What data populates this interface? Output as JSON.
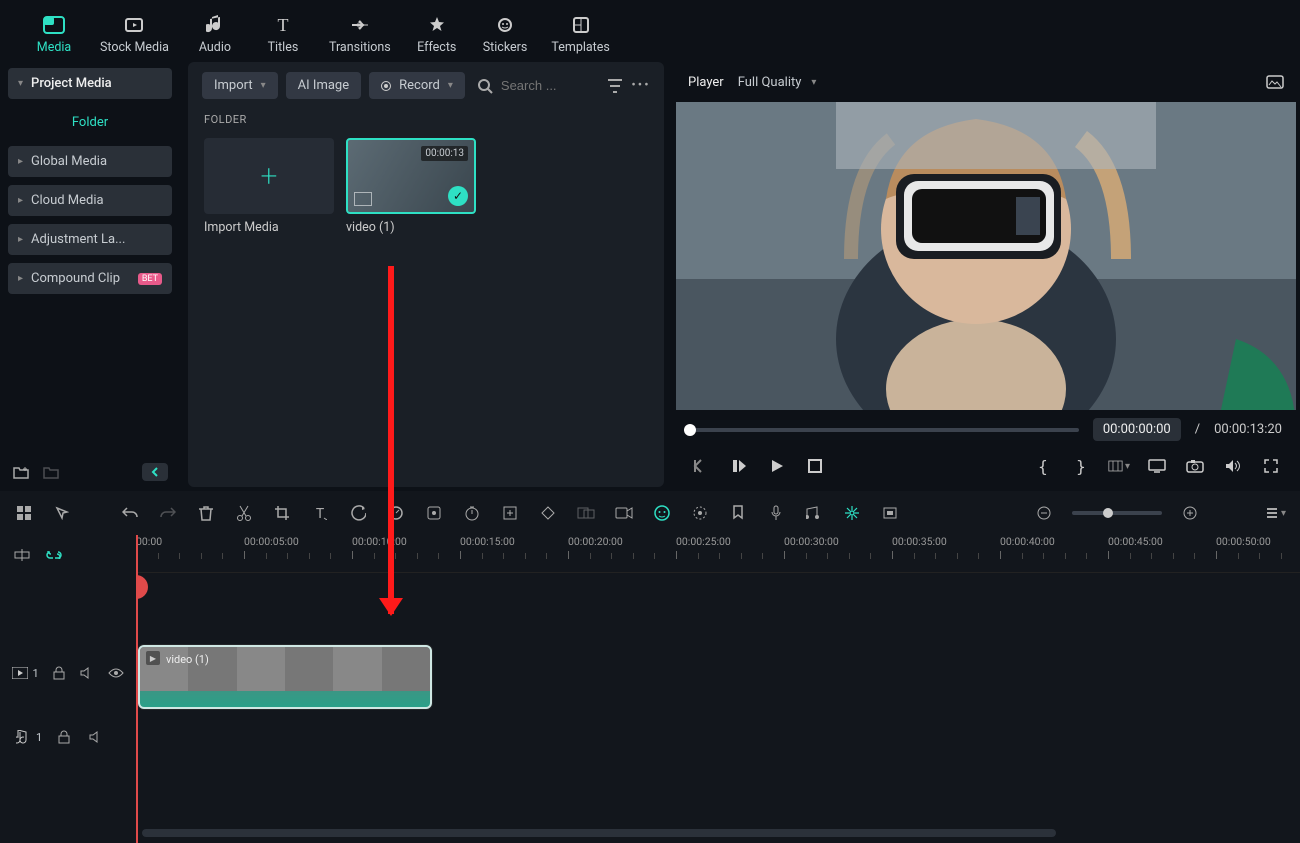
{
  "top_tabs": {
    "media": "Media",
    "stock": "Stock Media",
    "audio": "Audio",
    "titles": "Titles",
    "transitions": "Transitions",
    "effects": "Effects",
    "stickers": "Stickers",
    "templates": "Templates"
  },
  "sidebar": {
    "project_media": "Project Media",
    "folder": "Folder",
    "global_media": "Global Media",
    "cloud_media": "Cloud Media",
    "adjustment": "Adjustment La...",
    "compound": "Compound Clip",
    "compound_badge": "BET"
  },
  "media_toolbar": {
    "import": "Import",
    "ai_image": "AI Image",
    "record": "Record",
    "search_placeholder": "Search ..."
  },
  "folder_label": "FOLDER",
  "media_cards": {
    "import_media": "Import Media",
    "clip_name": "video (1)",
    "clip_duration": "00:00:13"
  },
  "player": {
    "label": "Player",
    "quality": "Full Quality",
    "current": "00:00:00:00",
    "divider": "/",
    "total": "00:00:13:20"
  },
  "timeline": {
    "ticks": [
      "00:00",
      "00:00:05:00",
      "00:00:10:00",
      "00:00:15:00",
      "00:00:20:00",
      "00:00:25:00",
      "00:00:30:00",
      "00:00:35:00",
      "00:00:40:00",
      "00:00:45:00",
      "00:00:50:00"
    ],
    "clip_label": "video (1)",
    "video_track_num": "1",
    "audio_track_num": "1"
  }
}
